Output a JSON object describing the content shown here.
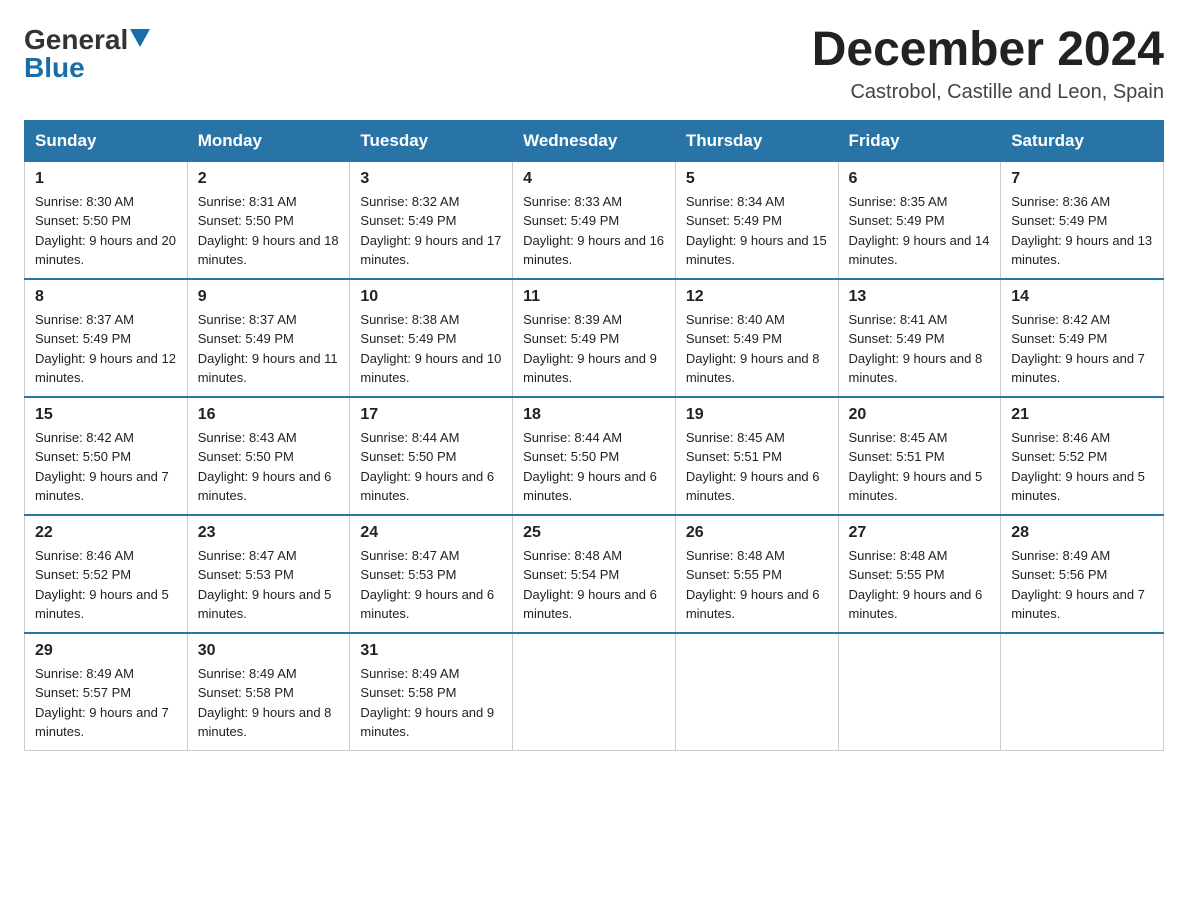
{
  "header": {
    "month_year": "December 2024",
    "location": "Castrobol, Castille and Leon, Spain"
  },
  "logo": {
    "general": "General",
    "blue": "Blue"
  },
  "days_of_week": [
    "Sunday",
    "Monday",
    "Tuesday",
    "Wednesday",
    "Thursday",
    "Friday",
    "Saturday"
  ],
  "weeks": [
    [
      {
        "day": "1",
        "sunrise": "8:30 AM",
        "sunset": "5:50 PM",
        "daylight": "9 hours and 20 minutes."
      },
      {
        "day": "2",
        "sunrise": "8:31 AM",
        "sunset": "5:50 PM",
        "daylight": "9 hours and 18 minutes."
      },
      {
        "day": "3",
        "sunrise": "8:32 AM",
        "sunset": "5:49 PM",
        "daylight": "9 hours and 17 minutes."
      },
      {
        "day": "4",
        "sunrise": "8:33 AM",
        "sunset": "5:49 PM",
        "daylight": "9 hours and 16 minutes."
      },
      {
        "day": "5",
        "sunrise": "8:34 AM",
        "sunset": "5:49 PM",
        "daylight": "9 hours and 15 minutes."
      },
      {
        "day": "6",
        "sunrise": "8:35 AM",
        "sunset": "5:49 PM",
        "daylight": "9 hours and 14 minutes."
      },
      {
        "day": "7",
        "sunrise": "8:36 AM",
        "sunset": "5:49 PM",
        "daylight": "9 hours and 13 minutes."
      }
    ],
    [
      {
        "day": "8",
        "sunrise": "8:37 AM",
        "sunset": "5:49 PM",
        "daylight": "9 hours and 12 minutes."
      },
      {
        "day": "9",
        "sunrise": "8:37 AM",
        "sunset": "5:49 PM",
        "daylight": "9 hours and 11 minutes."
      },
      {
        "day": "10",
        "sunrise": "8:38 AM",
        "sunset": "5:49 PM",
        "daylight": "9 hours and 10 minutes."
      },
      {
        "day": "11",
        "sunrise": "8:39 AM",
        "sunset": "5:49 PM",
        "daylight": "9 hours and 9 minutes."
      },
      {
        "day": "12",
        "sunrise": "8:40 AM",
        "sunset": "5:49 PM",
        "daylight": "9 hours and 8 minutes."
      },
      {
        "day": "13",
        "sunrise": "8:41 AM",
        "sunset": "5:49 PM",
        "daylight": "9 hours and 8 minutes."
      },
      {
        "day": "14",
        "sunrise": "8:42 AM",
        "sunset": "5:49 PM",
        "daylight": "9 hours and 7 minutes."
      }
    ],
    [
      {
        "day": "15",
        "sunrise": "8:42 AM",
        "sunset": "5:50 PM",
        "daylight": "9 hours and 7 minutes."
      },
      {
        "day": "16",
        "sunrise": "8:43 AM",
        "sunset": "5:50 PM",
        "daylight": "9 hours and 6 minutes."
      },
      {
        "day": "17",
        "sunrise": "8:44 AM",
        "sunset": "5:50 PM",
        "daylight": "9 hours and 6 minutes."
      },
      {
        "day": "18",
        "sunrise": "8:44 AM",
        "sunset": "5:50 PM",
        "daylight": "9 hours and 6 minutes."
      },
      {
        "day": "19",
        "sunrise": "8:45 AM",
        "sunset": "5:51 PM",
        "daylight": "9 hours and 6 minutes."
      },
      {
        "day": "20",
        "sunrise": "8:45 AM",
        "sunset": "5:51 PM",
        "daylight": "9 hours and 5 minutes."
      },
      {
        "day": "21",
        "sunrise": "8:46 AM",
        "sunset": "5:52 PM",
        "daylight": "9 hours and 5 minutes."
      }
    ],
    [
      {
        "day": "22",
        "sunrise": "8:46 AM",
        "sunset": "5:52 PM",
        "daylight": "9 hours and 5 minutes."
      },
      {
        "day": "23",
        "sunrise": "8:47 AM",
        "sunset": "5:53 PM",
        "daylight": "9 hours and 5 minutes."
      },
      {
        "day": "24",
        "sunrise": "8:47 AM",
        "sunset": "5:53 PM",
        "daylight": "9 hours and 6 minutes."
      },
      {
        "day": "25",
        "sunrise": "8:48 AM",
        "sunset": "5:54 PM",
        "daylight": "9 hours and 6 minutes."
      },
      {
        "day": "26",
        "sunrise": "8:48 AM",
        "sunset": "5:55 PM",
        "daylight": "9 hours and 6 minutes."
      },
      {
        "day": "27",
        "sunrise": "8:48 AM",
        "sunset": "5:55 PM",
        "daylight": "9 hours and 6 minutes."
      },
      {
        "day": "28",
        "sunrise": "8:49 AM",
        "sunset": "5:56 PM",
        "daylight": "9 hours and 7 minutes."
      }
    ],
    [
      {
        "day": "29",
        "sunrise": "8:49 AM",
        "sunset": "5:57 PM",
        "daylight": "9 hours and 7 minutes."
      },
      {
        "day": "30",
        "sunrise": "8:49 AM",
        "sunset": "5:58 PM",
        "daylight": "9 hours and 8 minutes."
      },
      {
        "day": "31",
        "sunrise": "8:49 AM",
        "sunset": "5:58 PM",
        "daylight": "9 hours and 9 minutes."
      },
      null,
      null,
      null,
      null
    ]
  ]
}
